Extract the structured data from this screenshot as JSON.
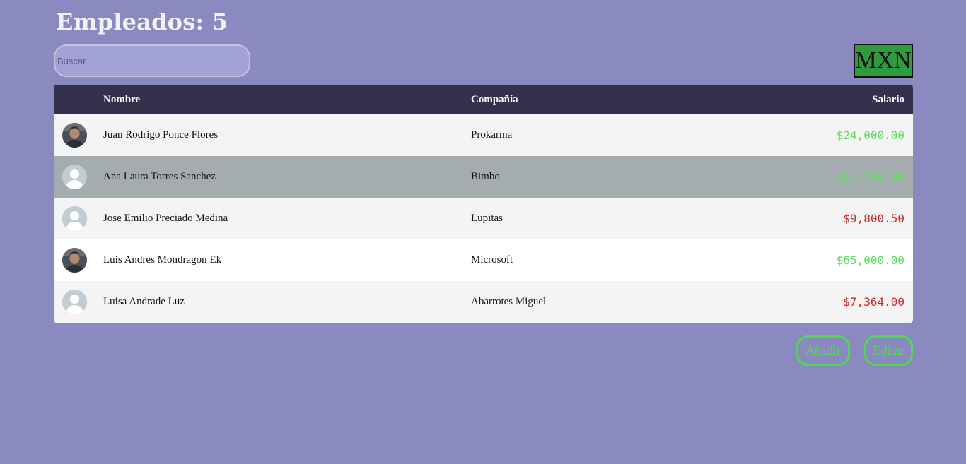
{
  "header": {
    "title": "Empleados: 5"
  },
  "search": {
    "placeholder": "Buscar",
    "value": ""
  },
  "currency": {
    "label": "MXN",
    "color": "#2e9b3c"
  },
  "table": {
    "columns": [
      "",
      "Nombre",
      "Compañía",
      "Salario"
    ],
    "rows": [
      {
        "avatar": "photo-avatar-icon",
        "name": "Juan Rodrigo Ponce Flores",
        "company": "Prokarma",
        "salary": "$24,000.00",
        "salary_color": "#5ee05e",
        "selected": false
      },
      {
        "avatar": "default-user-avatar-icon",
        "name": "Ana Laura Torres Sanchez",
        "company": "Bimbo",
        "salary": "$15,786.90",
        "salary_color": "#5ee05e",
        "selected": true
      },
      {
        "avatar": "default-user-avatar-icon",
        "name": "Jose Emilio Preciado Medina",
        "company": "Lupitas",
        "salary": "$9,800.50",
        "salary_color": "#d32626",
        "selected": false
      },
      {
        "avatar": "photo-avatar-icon",
        "name": "Luis Andres Mondragon Ek",
        "company": "Microsoft",
        "salary": "$65,000.00",
        "salary_color": "#5ee05e",
        "selected": false
      },
      {
        "avatar": "default-user-avatar-icon",
        "name": "Luisa Andrade Luz",
        "company": "Abarrotes Miguel",
        "salary": "$7,364.00",
        "salary_color": "#d32626",
        "selected": false
      }
    ]
  },
  "actions": {
    "add_label": "Añadir",
    "edit_label": "Editar"
  },
  "colors": {
    "background": "#8a89c0",
    "table_header": "#35304c",
    "selected_row": "#a4acaf",
    "positive_salary": "#5ee05e",
    "negative_salary": "#d32626",
    "action_border": "#4ddb4d"
  }
}
